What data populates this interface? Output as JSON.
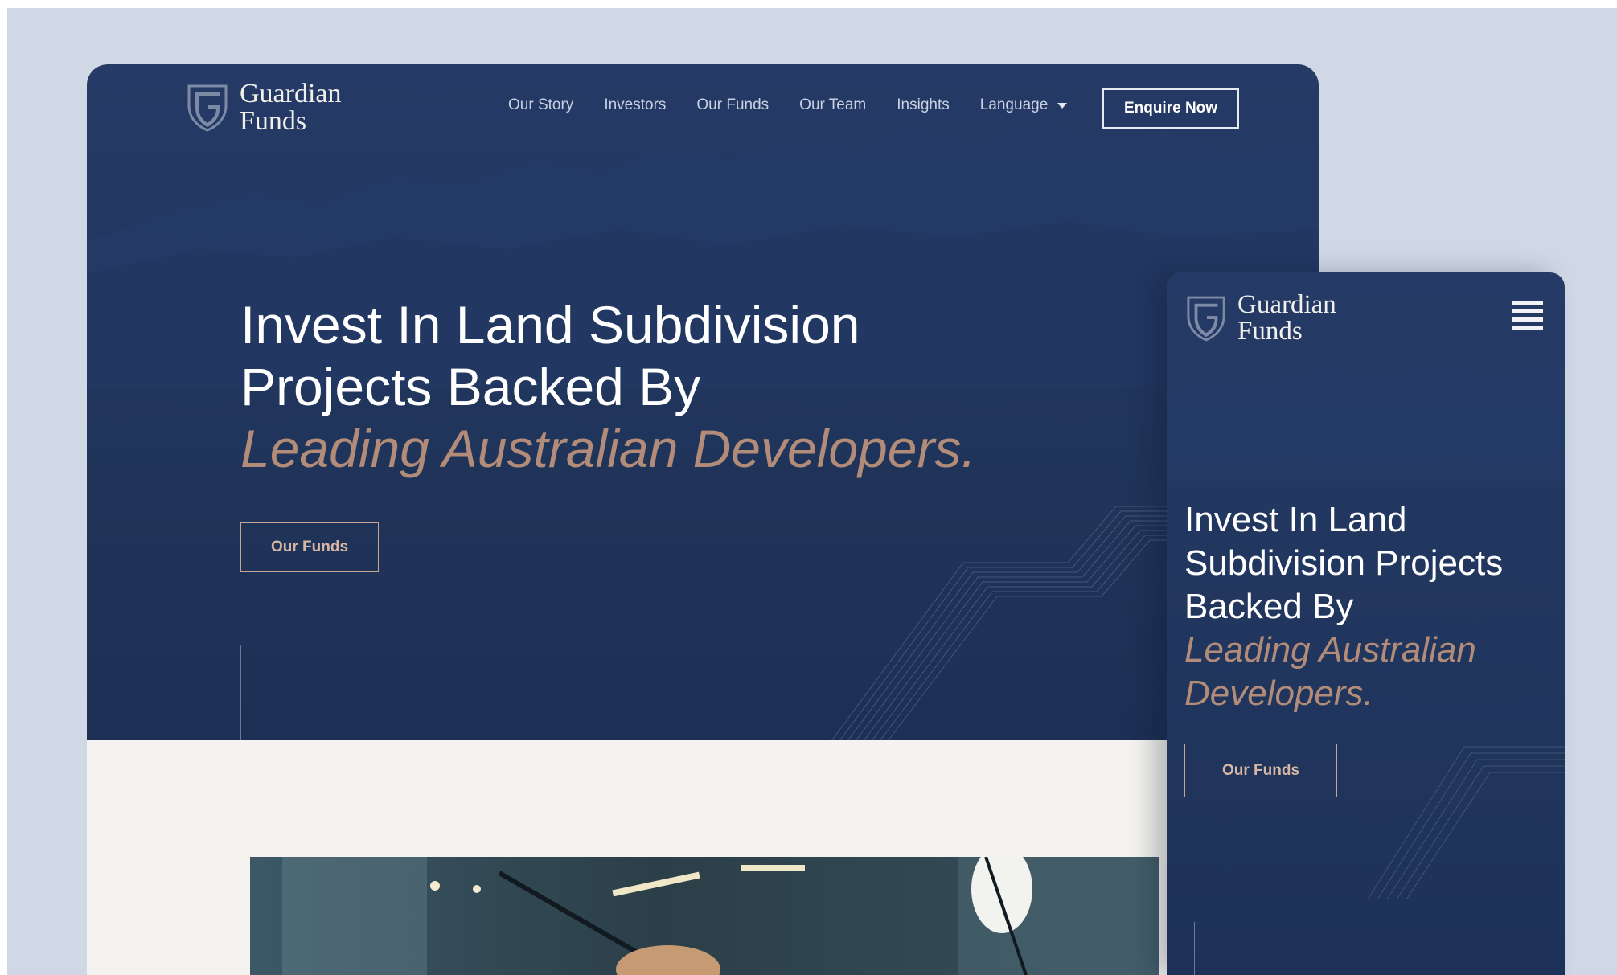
{
  "brand": {
    "line1": "Guardian",
    "line2": "Funds"
  },
  "nav": {
    "items": [
      {
        "label": "Our Story"
      },
      {
        "label": "Investors"
      },
      {
        "label": "Our Funds"
      },
      {
        "label": "Our Team"
      },
      {
        "label": "Insights"
      }
    ],
    "language_label": "Language",
    "cta_label": "Enquire Now"
  },
  "hero": {
    "headline_line1": "Invest In Land Subdivision",
    "headline_line2": "Projects Backed By",
    "headline_accent": "Leading Australian Developers.",
    "cta_label": "Our Funds"
  },
  "mobile": {
    "headline_lines": [
      "Invest In Land",
      "Subdivision Projects",
      "Backed By"
    ],
    "accent_lines": [
      "Leading Australian",
      "Developers."
    ],
    "cta_label": "Our Funds"
  },
  "colors": {
    "page_bg": "#d0d7e5",
    "hero_navy": "#223761",
    "accent_copper": "#b28c78",
    "section_light": "#f4f3ef"
  }
}
